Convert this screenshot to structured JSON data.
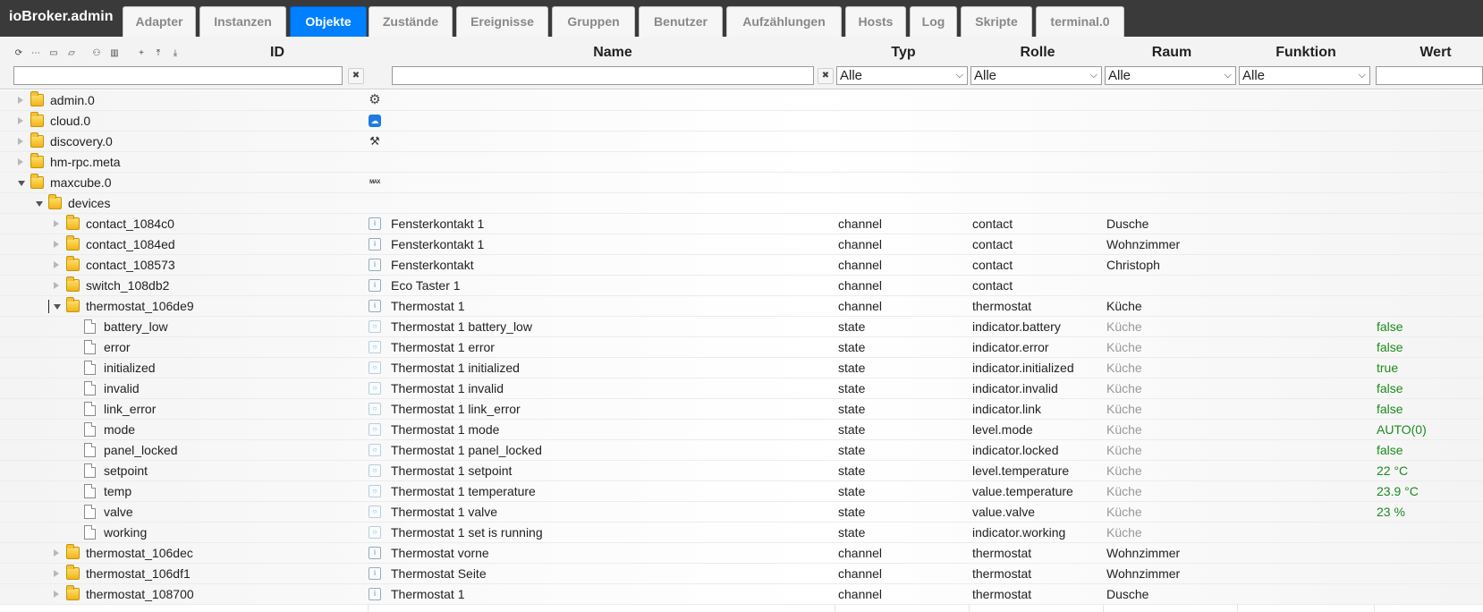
{
  "app": {
    "title": "ioBroker.admin"
  },
  "tabs": [
    {
      "label": "Adapter",
      "active": false
    },
    {
      "label": "Instanzen",
      "active": false
    },
    {
      "label": "Objekte",
      "active": true
    },
    {
      "label": "Zustände",
      "active": false
    },
    {
      "label": "Ereignisse",
      "active": false
    },
    {
      "label": "Gruppen",
      "active": false
    },
    {
      "label": "Benutzer",
      "active": false
    },
    {
      "label": "Aufzählungen",
      "active": false
    },
    {
      "label": "Hosts",
      "active": false
    },
    {
      "label": "Log",
      "active": false
    },
    {
      "label": "Skripte",
      "active": false
    },
    {
      "label": "terminal.0",
      "active": false
    }
  ],
  "toolbar": {
    "buttons": [
      "refresh-icon",
      "list-icon",
      "folder-icon",
      "folder-open-icon",
      "user-icon",
      "book-icon",
      "add-icon",
      "collapse-all-icon",
      "expand-all-icon"
    ]
  },
  "columns": {
    "id": "ID",
    "name": "Name",
    "type": "Typ",
    "role": "Rolle",
    "room": "Raum",
    "function": "Funktion",
    "value": "Wert"
  },
  "filters": {
    "id_value": "",
    "name_value": "",
    "clear_symbol": "✖",
    "type_selected": "Alle",
    "role_selected": "Alle",
    "room_selected": "Alle",
    "function_selected": "Alle",
    "value_value": ""
  },
  "rows": [
    {
      "id": "admin.0",
      "name": "",
      "type": "",
      "role": "",
      "room": "",
      "value": "",
      "icon": "gear-icon"
    },
    {
      "id": "cloud.0",
      "name": "",
      "type": "",
      "role": "",
      "room": "",
      "value": "",
      "icon": "cloud-icon"
    },
    {
      "id": "discovery.0",
      "name": "",
      "type": "",
      "role": "",
      "room": "",
      "value": "",
      "icon": "discovery-icon"
    },
    {
      "id": "hm-rpc.meta",
      "name": "",
      "type": "",
      "role": "",
      "room": "",
      "value": "",
      "icon": ""
    },
    {
      "id": "maxcube.0",
      "name": "",
      "type": "",
      "role": "",
      "room": "",
      "value": "",
      "icon": "max-logo-icon"
    },
    {
      "id": "devices",
      "name": "",
      "type": "",
      "role": "",
      "room": "",
      "value": "",
      "icon": ""
    },
    {
      "id": "contact_1084c0",
      "name": "Fensterkontakt 1",
      "type": "channel",
      "role": "contact",
      "room": "Dusche",
      "value": "",
      "icon": "channel-icon"
    },
    {
      "id": "contact_1084ed",
      "name": "Fensterkontakt 1",
      "type": "channel",
      "role": "contact",
      "room": "Wohnzimmer",
      "value": "",
      "icon": "channel-icon"
    },
    {
      "id": "contact_108573",
      "name": "Fensterkontakt",
      "type": "channel",
      "role": "contact",
      "room": "Christoph",
      "value": "",
      "icon": "channel-icon"
    },
    {
      "id": "switch_108db2",
      "name": "Eco Taster 1",
      "type": "channel",
      "role": "contact",
      "room": "",
      "value": "",
      "icon": "channel-icon"
    },
    {
      "id": "thermostat_106de9",
      "name": "Thermostat 1",
      "type": "channel",
      "role": "thermostat",
      "room": "Küche",
      "value": "",
      "icon": "channel-icon"
    },
    {
      "id": "battery_low",
      "name": "Thermostat 1 battery_low",
      "type": "state",
      "role": "indicator.battery",
      "room": "Küche",
      "value": "false",
      "icon": "state-icon"
    },
    {
      "id": "error",
      "name": "Thermostat 1 error",
      "type": "state",
      "role": "indicator.error",
      "room": "Küche",
      "value": "false",
      "icon": "state-icon"
    },
    {
      "id": "initialized",
      "name": "Thermostat 1 initialized",
      "type": "state",
      "role": "indicator.initialized",
      "room": "Küche",
      "value": "true",
      "icon": "state-icon"
    },
    {
      "id": "invalid",
      "name": "Thermostat 1 invalid",
      "type": "state",
      "role": "indicator.invalid",
      "room": "Küche",
      "value": "false",
      "icon": "state-icon"
    },
    {
      "id": "link_error",
      "name": "Thermostat 1 link_error",
      "type": "state",
      "role": "indicator.link",
      "room": "Küche",
      "value": "false",
      "icon": "state-icon"
    },
    {
      "id": "mode",
      "name": "Thermostat 1 mode",
      "type": "state",
      "role": "level.mode",
      "room": "Küche",
      "value": "AUTO(0)",
      "icon": "state-icon"
    },
    {
      "id": "panel_locked",
      "name": "Thermostat 1 panel_locked",
      "type": "state",
      "role": "indicator.locked",
      "room": "Küche",
      "value": "false",
      "icon": "state-icon"
    },
    {
      "id": "setpoint",
      "name": "Thermostat 1 setpoint",
      "type": "state",
      "role": "level.temperature",
      "room": "Küche",
      "value": "22 °C",
      "icon": "state-icon"
    },
    {
      "id": "temp",
      "name": "Thermostat 1 temperature",
      "type": "state",
      "role": "value.temperature",
      "room": "Küche",
      "value": "23.9 °C",
      "icon": "state-icon"
    },
    {
      "id": "valve",
      "name": "Thermostat 1 valve",
      "type": "state",
      "role": "value.valve",
      "room": "Küche",
      "value": "23 %",
      "icon": "state-icon"
    },
    {
      "id": "working",
      "name": "Thermostat 1 set is running",
      "type": "state",
      "role": "indicator.working",
      "room": "Küche",
      "value": "",
      "icon": "state-icon"
    },
    {
      "id": "thermostat_106dec",
      "name": "Thermostat vorne",
      "type": "channel",
      "role": "thermostat",
      "room": "Wohnzimmer",
      "value": "",
      "icon": "channel-icon"
    },
    {
      "id": "thermostat_106df1",
      "name": "Thermostat Seite",
      "type": "channel",
      "role": "thermostat",
      "room": "Wohnzimmer",
      "value": "",
      "icon": "channel-icon"
    },
    {
      "id": "thermostat_108700",
      "name": "Thermostat 1",
      "type": "channel",
      "role": "thermostat",
      "room": "Dusche",
      "value": "",
      "icon": "channel-icon"
    }
  ]
}
